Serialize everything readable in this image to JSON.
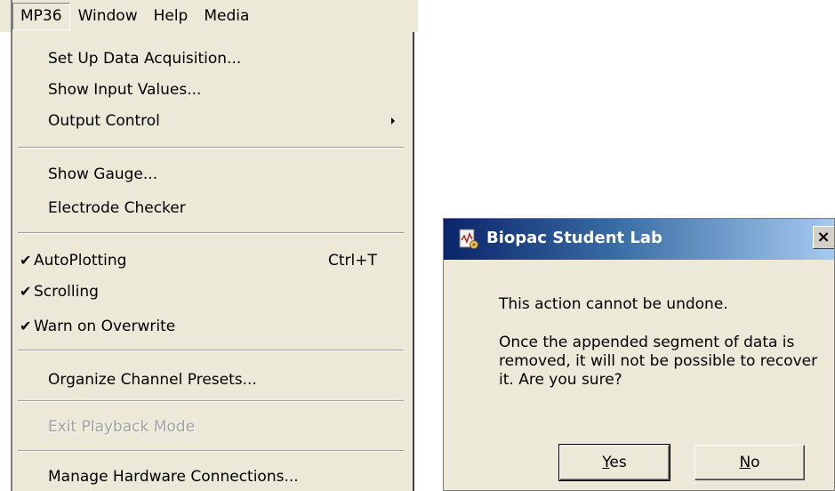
{
  "menubar": {
    "items": [
      {
        "label": "MP36",
        "active": true
      },
      {
        "label": "Window"
      },
      {
        "label": "Help"
      },
      {
        "label": "Media"
      }
    ]
  },
  "menu": {
    "set_up": "Set Up Data Acquisition...",
    "show_input": "Show Input Values...",
    "output_control": "Output Control",
    "show_gauge": "Show Gauge...",
    "electrode_checker": "Electrode Checker",
    "autoplotting": "AutoPlotting",
    "autoplotting_shortcut": "Ctrl+T",
    "autoplotting_checked": true,
    "scrolling": "Scrolling",
    "scrolling_checked": true,
    "warn_overwrite": "Warn on Overwrite",
    "warn_overwrite_checked": true,
    "organize_presets": "Organize Channel Presets...",
    "exit_playback": "Exit Playback Mode",
    "exit_playback_enabled": false,
    "manage_hardware": "Manage Hardware Connections...",
    "check_glyph": "✔"
  },
  "dialog": {
    "title": "Biopac Student Lab",
    "close_glyph": "×",
    "message_line1": "This action cannot be undone.",
    "message_line2": "Once the appended segment of data is removed, it will not be possible to recover it.  Are you sure?",
    "yes_mnemonic": "Y",
    "yes_rest": "es",
    "no_mnemonic": "N",
    "no_rest": "o"
  },
  "colors": {
    "menu_bg": "#ece9d8",
    "title_start": "#0a246a",
    "title_end": "#a6caf0",
    "disabled_text": "#a0a0a0"
  },
  "icons": {
    "title_icon": "biopac-app-icon",
    "submenu": "submenu-arrow-icon",
    "check": "check-icon"
  }
}
